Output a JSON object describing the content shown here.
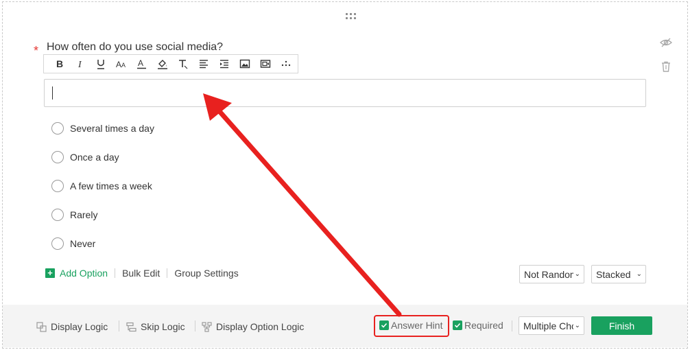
{
  "question": {
    "required_mark": "*",
    "title": "How often do you use social media?",
    "hint_placeholder": ""
  },
  "toolbar": {
    "items": [
      "bold-icon",
      "italic-icon",
      "underline-icon",
      "font-size-icon",
      "font-color-icon",
      "highlight-icon",
      "clear-format-icon",
      "align-icon",
      "indent-icon",
      "image-icon",
      "media-icon",
      "more-icon"
    ]
  },
  "options": [
    {
      "label": "Several times a day"
    },
    {
      "label": "Once a day"
    },
    {
      "label": "A few times a week"
    },
    {
      "label": "Rarely"
    },
    {
      "label": "Never"
    }
  ],
  "actions": {
    "add_option": "Add Option",
    "bulk_edit": "Bulk Edit",
    "group_settings": "Group Settings"
  },
  "selects": {
    "randomize": "Not Random",
    "layout": "Stacked",
    "question_type": "Multiple Choice"
  },
  "bottom": {
    "display_logic": "Display Logic",
    "skip_logic": "Skip Logic",
    "display_option_logic": "Display Option Logic",
    "answer_hint": "Answer Hint",
    "answer_hint_checked": true,
    "required": "Required",
    "required_checked": true,
    "finish": "Finish"
  },
  "colors": {
    "accent": "#19a15f",
    "annotation": "#e8211f",
    "required": "#e53935"
  }
}
